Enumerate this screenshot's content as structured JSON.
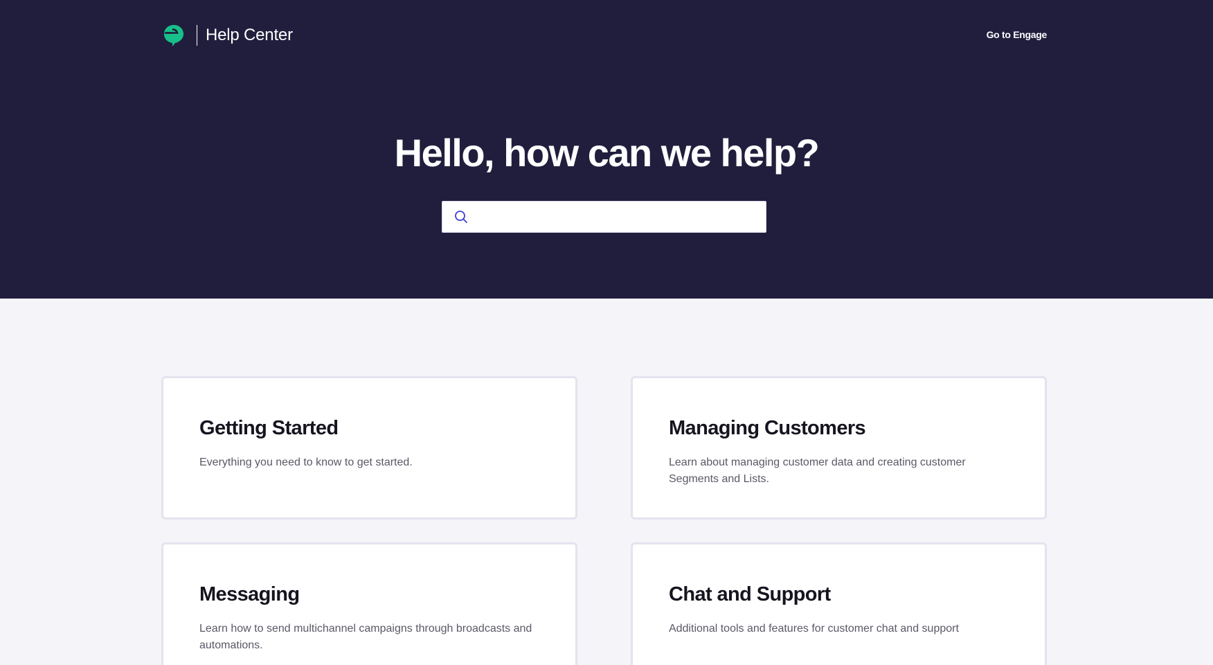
{
  "header": {
    "logo_icon": "engage-speech-bubble-icon",
    "brand_title": "Help Center",
    "nav_link": "Go to Engage"
  },
  "hero": {
    "title": "Hello, how can we help?",
    "search": {
      "placeholder": "",
      "value": "",
      "icon": "search-icon"
    }
  },
  "categories": [
    {
      "title": "Getting Started",
      "description": "Everything you need to know to get started."
    },
    {
      "title": "Managing Customers",
      "description": "Learn about managing customer data and creating customer Segments and Lists."
    },
    {
      "title": "Messaging",
      "description": "Learn how to send multichannel campaigns through broadcasts and automations."
    },
    {
      "title": "Chat and Support",
      "description": "Additional tools and features for customer chat and support"
    }
  ],
  "colors": {
    "hero_background": "#211e3d",
    "page_background": "#f5f5f9",
    "brand_green": "#17c08b",
    "search_icon": "#3d3cd6"
  }
}
